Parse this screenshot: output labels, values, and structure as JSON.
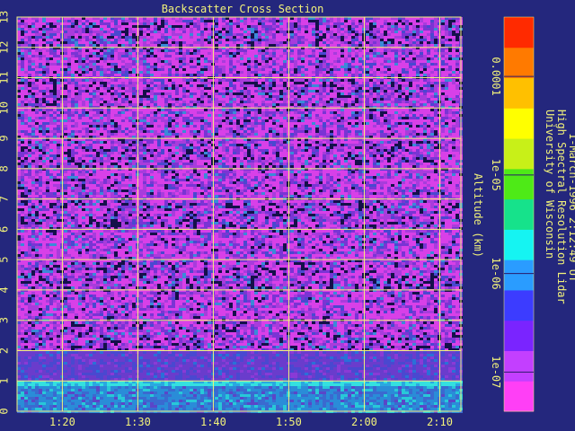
{
  "chart_data": {
    "type": "heatmap",
    "title": "Backscatter Cross Section",
    "xlabel": "",
    "ylabel": "Altitude (km)",
    "x_ticks": [
      "1:20",
      "1:30",
      "1:40",
      "1:50",
      "2:00",
      "2:10"
    ],
    "x_tick_minutes": [
      80,
      90,
      100,
      110,
      120,
      130
    ],
    "x_range_minutes": [
      74,
      132.8
    ],
    "y_ticks": [
      0,
      1,
      2,
      3,
      4,
      5,
      6,
      7,
      8,
      9,
      10,
      11,
      12,
      13
    ],
    "ylim": [
      0,
      13
    ],
    "grid": true,
    "colorbar": {
      "scale": "log",
      "range": [
        4e-08,
        0.0004
      ],
      "tick_labels": [
        "0.0001",
        "1e-05",
        "1e-06",
        "1e-07"
      ],
      "tick_values": [
        0.0001,
        1e-05,
        1e-06,
        1e-07
      ],
      "colormap": [
        "#ff3ff6",
        "#c33fff",
        "#7a24ff",
        "#3c3cff",
        "#2a9cff",
        "#15f4f2",
        "#16e28b",
        "#4eea17",
        "#c8f018",
        "#ffff00",
        "#ffc000",
        "#ff7a00",
        "#ff2a00"
      ]
    },
    "layers": [
      {
        "altitude_km": [
          0,
          0.9
        ],
        "level": "1e-06 to 5e-07"
      },
      {
        "altitude_km": [
          0.9,
          1.0
        ],
        "level": "about 1e-06"
      },
      {
        "altitude_km": [
          1.0,
          2.0
        ],
        "level": "about 1.5e-07"
      },
      {
        "altitude_km": [
          2.0,
          13
        ],
        "level": "below 1e-07"
      }
    ]
  },
  "side_text": {
    "line1": "University of Wisconsin",
    "line2": "High Spectral Resolution Lidar",
    "line3": "1-March-1996  2:12:49 UT"
  },
  "colors": {
    "background": "#24277d",
    "grid": "#f2f27a",
    "text": "#f2f27a"
  }
}
